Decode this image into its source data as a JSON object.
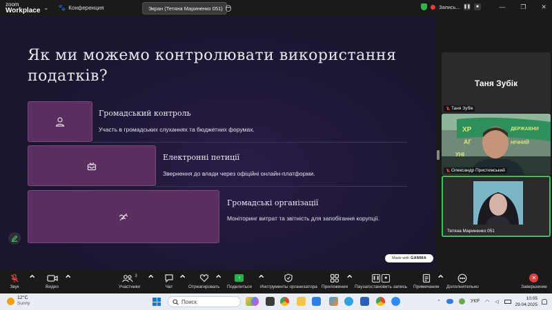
{
  "topbar": {
    "logo_line1": "zoom",
    "logo_line2": "Workplace",
    "meeting_label": "Конференция",
    "share_label": "Экран (Тетяна Мариненко 051)",
    "recording_label": "Запись..."
  },
  "slide": {
    "title": "Як ми можемо контролювати використання податків?",
    "items": [
      {
        "title": "Громадський контроль",
        "description": "Участь в громадських слуханнях та бюджетних форумах.",
        "icon": "person-icon"
      },
      {
        "title": "Електронні петиції",
        "description": "Звернення до влади через офіційні онлайн-платформи.",
        "icon": "inbox-icon"
      },
      {
        "title": "Громадські організації",
        "description": "Моніторинг витрат та звітність для запобігання корупції.",
        "icon": "handshake-icon"
      }
    ],
    "made_with_prefix": "Made with",
    "made_with_brand": "GAMMA"
  },
  "participants": [
    {
      "name": "Таня Зубік",
      "display": "Таня Зубік",
      "muted": true
    },
    {
      "name": "Олександр Пристемський",
      "muted": true
    },
    {
      "name": "Тетяна Мариненко 051",
      "muted": false
    }
  ],
  "toolbar": {
    "audio": "Звук",
    "video": "Видео",
    "participants": "Участники",
    "participants_count": "3",
    "chat": "Чат",
    "react": "Отреагировать",
    "share": "Поделиться",
    "host_tools": "Инструменты организатора",
    "apps": "Приложения",
    "pause_record": "Пауза/остановить запись",
    "notes": "Примечания",
    "more": "Дополнительно",
    "end": "Завершение"
  },
  "taskbar": {
    "temperature": "12°C",
    "weather": "Sunny",
    "search_placeholder": "Поиск",
    "language": "УКР",
    "time": "10:05",
    "date": "29.04.2025"
  },
  "colors": {
    "slide_bg": "#1a1630",
    "card_bg": "#5a2f5f",
    "active_speaker": "#34c85a",
    "record_red": "#e0403b",
    "share_green": "#22b14c"
  }
}
